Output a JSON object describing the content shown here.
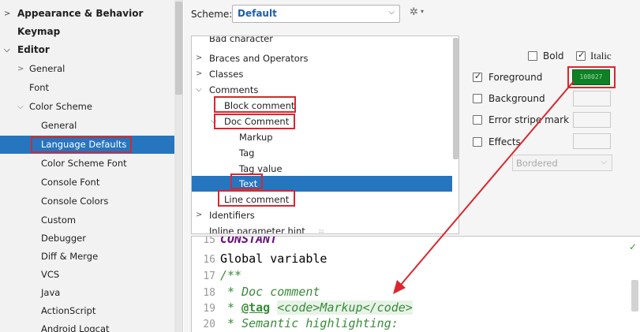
{
  "sidebar": {
    "items": [
      {
        "label": "Appearance & Behavior"
      },
      {
        "label": "Keymap"
      },
      {
        "label": "Editor"
      },
      {
        "label": "General"
      },
      {
        "label": "Font"
      },
      {
        "label": "Color Scheme"
      },
      {
        "label": "General"
      },
      {
        "label": "Language Defaults"
      },
      {
        "label": "Color Scheme Font"
      },
      {
        "label": "Console Font"
      },
      {
        "label": "Console Colors"
      },
      {
        "label": "Custom"
      },
      {
        "label": "Debugger"
      },
      {
        "label": "Diff & Merge"
      },
      {
        "label": "VCS"
      },
      {
        "label": "Java"
      },
      {
        "label": "ActionScript"
      },
      {
        "label": "Android Logcat"
      }
    ],
    "selected": "Language Defaults"
  },
  "scheme": {
    "label": "Scheme:",
    "value": "Default"
  },
  "tree": {
    "rows": [
      {
        "label": "Bad character"
      },
      {
        "label": "Braces and Operators"
      },
      {
        "label": "Classes"
      },
      {
        "label": "Comments"
      },
      {
        "label": "Block comment"
      },
      {
        "label": "Doc Comment"
      },
      {
        "label": "Markup"
      },
      {
        "label": "Tag"
      },
      {
        "label": "Tag value"
      },
      {
        "label": "Text"
      },
      {
        "label": "Line comment"
      },
      {
        "label": "Identifiers"
      },
      {
        "label": "Inline parameter hint"
      }
    ],
    "selected": "Text"
  },
  "attributes": {
    "bold": {
      "label": "Bold",
      "checked": false
    },
    "italic": {
      "label": "Italic",
      "checked": true
    },
    "foreground": {
      "label": "Foreground",
      "checked": true,
      "color_text": "108027",
      "color": "#108027"
    },
    "background": {
      "label": "Background",
      "checked": false
    },
    "error_stripe": {
      "label": "Error stripe mark",
      "checked": false
    },
    "effects": {
      "label": "Effects",
      "checked": false,
      "type": "Bordered"
    }
  },
  "preview": {
    "lines": [
      {
        "num": "15",
        "text": "CONSTANT"
      },
      {
        "num": "16",
        "text": "Global variable"
      },
      {
        "num": "17",
        "text": "/**"
      },
      {
        "num": "18",
        "text": " * Doc comment"
      },
      {
        "num": "19",
        "star": " * ",
        "tag": "@tag",
        "space": " ",
        "markup": "<code>Markup</code>"
      },
      {
        "num": "20",
        "text": " * Semantic highlighting:"
      }
    ]
  },
  "colors": {
    "selection": "#2675bf",
    "highlight_box": "#d9272e",
    "foreground_swatch": "#108027"
  }
}
